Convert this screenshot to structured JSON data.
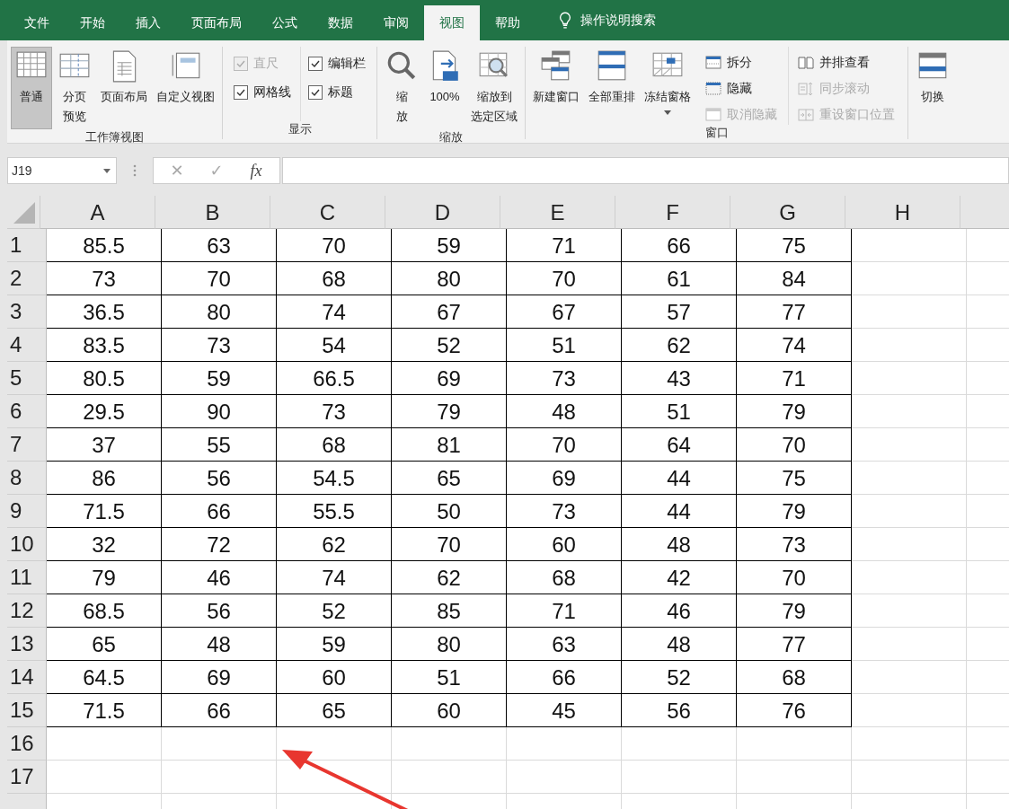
{
  "tabs": [
    {
      "label": "文件",
      "selected": false
    },
    {
      "label": "开始",
      "selected": false
    },
    {
      "label": "插入",
      "selected": false
    },
    {
      "label": "页面布局",
      "selected": false
    },
    {
      "label": "公式",
      "selected": false
    },
    {
      "label": "数据",
      "selected": false
    },
    {
      "label": "审阅",
      "selected": false
    },
    {
      "label": "视图",
      "selected": true
    },
    {
      "label": "帮助",
      "selected": false
    }
  ],
  "search": {
    "label": "操作说明搜索"
  },
  "ribbon": {
    "groups": [
      {
        "label": "工作簿视图",
        "items": [
          {
            "kind": "large",
            "label": "普通",
            "selected": true
          },
          {
            "kind": "large",
            "lines": [
              "分页",
              "预览"
            ],
            "selected": false
          },
          {
            "kind": "large",
            "label": "页面布局",
            "selected": false
          },
          {
            "kind": "large",
            "label": "自定义视图",
            "selected": false
          }
        ]
      },
      {
        "label": "显示",
        "items": [
          {
            "kind": "stack",
            "items": [
              {
                "kind": "checkbox",
                "label": "直尺",
                "checked": true,
                "disabled": true
              },
              {
                "kind": "checkbox",
                "label": "网格线",
                "checked": true,
                "disabled": false
              }
            ]
          },
          {
            "kind": "stack",
            "items": [
              {
                "kind": "checkbox",
                "label": "编辑栏",
                "checked": true,
                "disabled": false
              },
              {
                "kind": "checkbox",
                "label": "标题",
                "checked": true,
                "disabled": false
              }
            ]
          }
        ]
      },
      {
        "label": "缩放",
        "items": [
          {
            "kind": "large",
            "lines": [
              "缩",
              "放"
            ],
            "selected": false
          },
          {
            "kind": "large",
            "label": "100%",
            "selected": false
          },
          {
            "kind": "large",
            "lines": [
              "缩放到",
              "选定区域"
            ],
            "selected": false
          }
        ]
      },
      {
        "label": "窗口",
        "items": [
          {
            "kind": "large",
            "label": "新建窗口",
            "selected": false
          },
          {
            "kind": "large",
            "label": "全部重排",
            "selected": false
          },
          {
            "kind": "large",
            "label": "冻结窗格",
            "selected": false,
            "dropdown": true
          },
          {
            "kind": "stack",
            "items": [
              {
                "kind": "small",
                "label": "拆分",
                "disabled": false
              },
              {
                "kind": "small",
                "label": "隐藏",
                "disabled": false
              },
              {
                "kind": "small",
                "label": "取消隐藏",
                "disabled": true
              }
            ]
          },
          {
            "kind": "stack",
            "items": [
              {
                "kind": "small",
                "label": "并排查看",
                "disabled": false
              },
              {
                "kind": "small",
                "label": "同步滚动",
                "disabled": true
              },
              {
                "kind": "small",
                "label": "重设窗口位置",
                "disabled": true
              }
            ]
          }
        ]
      },
      {
        "items": [
          {
            "kind": "large",
            "label": "切换",
            "selected": false
          }
        ]
      }
    ]
  },
  "formula_bar": {
    "name_box": "J19",
    "cancel": "✕",
    "enter": "✓",
    "function": "fx"
  },
  "sheet": {
    "columns": [
      "A",
      "B",
      "C",
      "D",
      "E",
      "F",
      "G",
      "H"
    ],
    "rows": [
      {
        "header": "1",
        "cells": [
          "85.5",
          "63",
          "70",
          "59",
          "71",
          "66",
          "75"
        ]
      },
      {
        "header": "2",
        "cells": [
          "73",
          "70",
          "68",
          "80",
          "70",
          "61",
          "84"
        ]
      },
      {
        "header": "3",
        "cells": [
          "36.5",
          "80",
          "74",
          "67",
          "67",
          "57",
          "77"
        ]
      },
      {
        "header": "4",
        "cells": [
          "83.5",
          "73",
          "54",
          "52",
          "51",
          "62",
          "74"
        ]
      },
      {
        "header": "5",
        "cells": [
          "80.5",
          "59",
          "66.5",
          "69",
          "73",
          "43",
          "71"
        ]
      },
      {
        "header": "6",
        "cells": [
          "29.5",
          "90",
          "73",
          "79",
          "48",
          "51",
          "79"
        ]
      },
      {
        "header": "7",
        "cells": [
          "37",
          "55",
          "68",
          "81",
          "70",
          "64",
          "70"
        ]
      },
      {
        "header": "8",
        "cells": [
          "86",
          "56",
          "54.5",
          "65",
          "69",
          "44",
          "75"
        ]
      },
      {
        "header": "9",
        "cells": [
          "71.5",
          "66",
          "55.5",
          "50",
          "73",
          "44",
          "79"
        ]
      },
      {
        "header": "10",
        "cells": [
          "32",
          "72",
          "62",
          "70",
          "60",
          "48",
          "73"
        ]
      },
      {
        "header": "11",
        "cells": [
          "79",
          "46",
          "74",
          "62",
          "68",
          "42",
          "70"
        ]
      },
      {
        "header": "12",
        "cells": [
          "68.5",
          "56",
          "52",
          "85",
          "71",
          "46",
          "79"
        ]
      },
      {
        "header": "13",
        "cells": [
          "65",
          "48",
          "59",
          "80",
          "63",
          "48",
          "77"
        ]
      },
      {
        "header": "14",
        "cells": [
          "64.5",
          "69",
          "60",
          "51",
          "66",
          "52",
          "68"
        ]
      },
      {
        "header": "15",
        "cells": [
          "71.5",
          "66",
          "65",
          "60",
          "45",
          "56",
          "76"
        ]
      },
      {
        "header": "16",
        "cells": []
      },
      {
        "header": "17",
        "cells": []
      }
    ]
  }
}
